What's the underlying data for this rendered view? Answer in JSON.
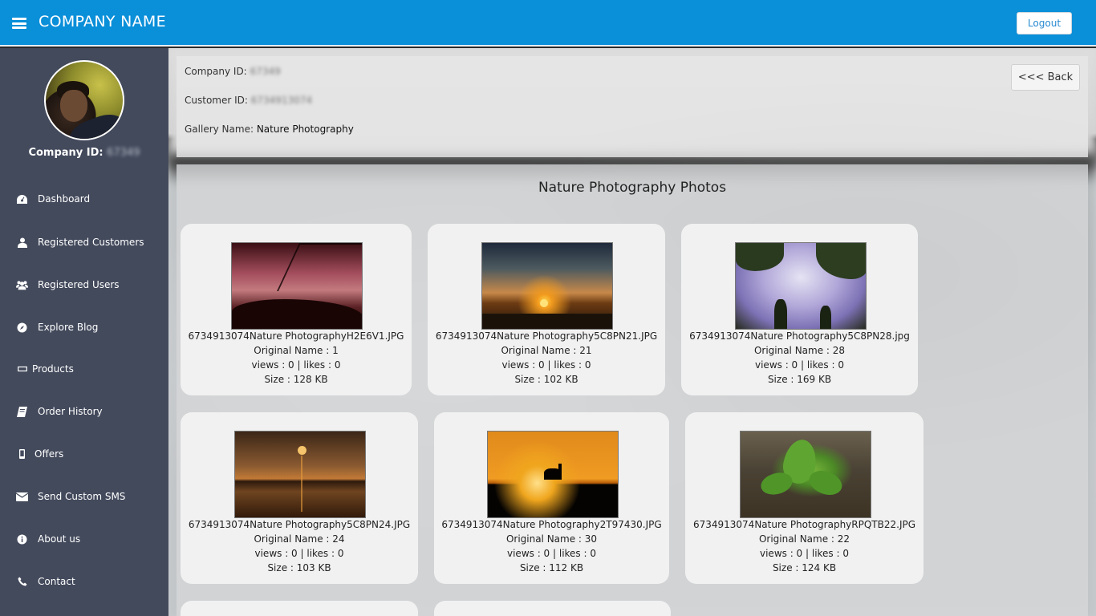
{
  "header": {
    "brand": "COMPANY NAME",
    "logout_label": "Logout"
  },
  "sidebar": {
    "company_id_label": "Company ID:",
    "company_id_value": "67349",
    "items": [
      {
        "label": "Dashboard",
        "icon": "dashboard-icon"
      },
      {
        "label": "Registered Customers",
        "icon": "user-icon"
      },
      {
        "label": "Registered Users",
        "icon": "users-icon"
      },
      {
        "label": "Explore Blog",
        "icon": "compass-icon"
      },
      {
        "label": "Products",
        "icon": "rectangle-icon"
      },
      {
        "label": "Order History",
        "icon": "book-icon"
      },
      {
        "label": "Offers",
        "icon": "mobile-icon"
      },
      {
        "label": "Send Custom SMS",
        "icon": "envelope-icon"
      },
      {
        "label": "About us",
        "icon": "info-icon"
      },
      {
        "label": "Contact",
        "icon": "phone-icon"
      }
    ]
  },
  "info": {
    "company_id_label": "Company ID:",
    "company_id_value": "67349",
    "customer_id_label": "Customer ID:",
    "customer_id_value": "6734913074",
    "gallery_name_label": "Gallery Name:",
    "gallery_name_value": "Nature Photography",
    "back_label": "<<< Back"
  },
  "gallery": {
    "title": "Nature Photography Photos",
    "photos": [
      {
        "filename": "6734913074Nature PhotographyH2E6V1.JPG",
        "original_name": "Original Name :  1",
        "stats": "views :  0  | likes :  0",
        "size": "Size :  128 KB"
      },
      {
        "filename": "6734913074Nature Photography5C8PN21.JPG",
        "original_name": "Original Name :  21",
        "stats": "views :  0  | likes :  0",
        "size": "Size :  102 KB"
      },
      {
        "filename": "6734913074Nature Photography5C8PN28.jpg",
        "original_name": "Original Name :  28",
        "stats": "views :  0  | likes :  0",
        "size": "Size :  169 KB"
      },
      {
        "filename": "6734913074Nature Photography5C8PN24.JPG",
        "original_name": "Original Name :  24",
        "stats": "views :  0  | likes :  0",
        "size": "Size :  103 KB"
      },
      {
        "filename": "6734913074Nature Photography2T97430.JPG",
        "original_name": "Original Name :  30",
        "stats": "views :  0  | likes :  0",
        "size": "Size :  112 KB"
      },
      {
        "filename": "6734913074Nature PhotographyRPQTB22.JPG",
        "original_name": "Original Name :  22",
        "stats": "views :  0  | likes :  0",
        "size": "Size :  124 KB"
      }
    ]
  }
}
